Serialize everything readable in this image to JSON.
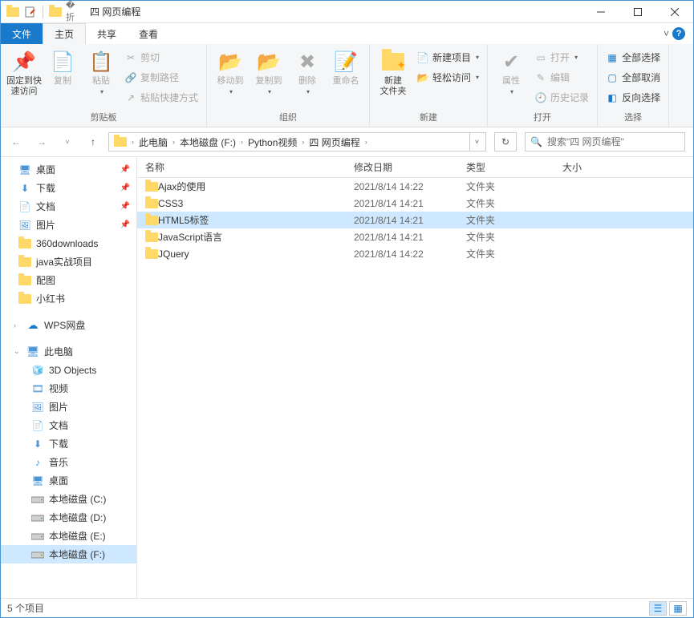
{
  "window": {
    "title": "四 网页编程"
  },
  "tabs": {
    "file": "文件",
    "home": "主页",
    "share": "共享",
    "view": "查看"
  },
  "ribbon": {
    "group_clipboard": "剪贴板",
    "group_organize": "组织",
    "group_new": "新建",
    "group_open": "打开",
    "group_select": "选择",
    "pin": "固定到快\n速访问",
    "copy": "复制",
    "paste": "粘贴",
    "cut": "剪切",
    "copy_path": "复制路径",
    "paste_shortcut": "粘贴快捷方式",
    "move_to": "移动到",
    "copy_to": "复制到",
    "delete": "删除",
    "rename": "重命名",
    "new_folder": "新建\n文件夹",
    "new_item": "新建项目",
    "easy_access": "轻松访问",
    "properties": "属性",
    "open": "打开",
    "edit": "编辑",
    "history": "历史记录",
    "select_all": "全部选择",
    "select_none": "全部取消",
    "invert_selection": "反向选择"
  },
  "breadcrumb": [
    "此电脑",
    "本地磁盘 (F:)",
    "Python视频",
    "四 网页编程"
  ],
  "search_placeholder": "搜索\"四 网页编程\"",
  "columns": {
    "name": "名称",
    "date": "修改日期",
    "type": "类型",
    "size": "大小"
  },
  "sidebar": {
    "quick": [
      {
        "icon": "desktop",
        "label": "桌面",
        "pinned": true
      },
      {
        "icon": "download",
        "label": "下载",
        "pinned": true
      },
      {
        "icon": "document",
        "label": "文档",
        "pinned": true
      },
      {
        "icon": "pictures",
        "label": "图片",
        "pinned": true
      },
      {
        "icon": "folder",
        "label": "360downloads"
      },
      {
        "icon": "folder",
        "label": "java实战项目"
      },
      {
        "icon": "folder",
        "label": "配图"
      },
      {
        "icon": "folder",
        "label": "小红书"
      }
    ],
    "wps": "WPS网盘",
    "thispc": "此电脑",
    "pc_items": [
      {
        "icon": "3d",
        "label": "3D Objects"
      },
      {
        "icon": "video",
        "label": "视频"
      },
      {
        "icon": "pictures",
        "label": "图片"
      },
      {
        "icon": "document",
        "label": "文档"
      },
      {
        "icon": "download",
        "label": "下载"
      },
      {
        "icon": "music",
        "label": "音乐"
      },
      {
        "icon": "desktop",
        "label": "桌面"
      },
      {
        "icon": "drive",
        "label": "本地磁盘 (C:)"
      },
      {
        "icon": "drive",
        "label": "本地磁盘 (D:)"
      },
      {
        "icon": "drive",
        "label": "本地磁盘 (E:)"
      },
      {
        "icon": "drive",
        "label": "本地磁盘 (F:)",
        "selected": true
      }
    ]
  },
  "files": [
    {
      "name": "Ajax的使用",
      "date": "2021/8/14 14:22",
      "type": "文件夹"
    },
    {
      "name": "CSS3",
      "date": "2021/8/14 14:21",
      "type": "文件夹"
    },
    {
      "name": "HTML5标签",
      "date": "2021/8/14 14:21",
      "type": "文件夹",
      "selected": true
    },
    {
      "name": "JavaScript语言",
      "date": "2021/8/14 14:21",
      "type": "文件夹"
    },
    {
      "name": "JQuery",
      "date": "2021/8/14 14:22",
      "type": "文件夹"
    }
  ],
  "status": "5 个项目"
}
